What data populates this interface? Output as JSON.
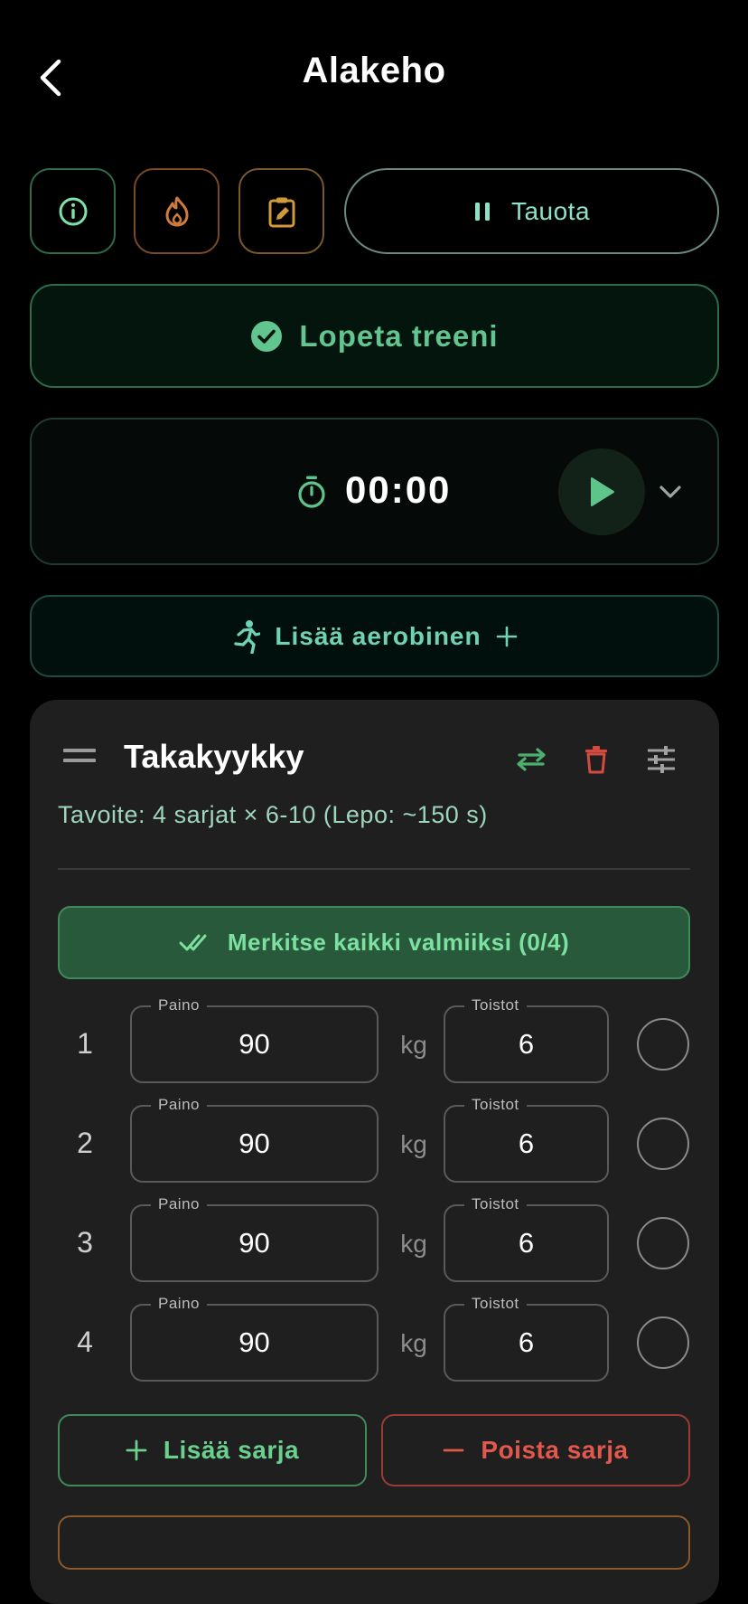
{
  "header": {
    "title": "Alakeho"
  },
  "toolbar": {
    "pause_label": "Tauota"
  },
  "finish": {
    "label": "Lopeta treeni"
  },
  "timer": {
    "value": "00:00"
  },
  "cardio": {
    "label": "Lisää aerobinen"
  },
  "exercise": {
    "name": "Takakyykky",
    "target": "Tavoite: 4 sarjat × 6-10 (Lepo: ~150 s)",
    "mark_all_label": "Merkitse kaikki valmiiksi (0/4)",
    "weight_label": "Paino",
    "reps_label": "Toistot",
    "unit": "kg",
    "sets": [
      {
        "num": "1",
        "weight": "90",
        "reps": "6",
        "done": false
      },
      {
        "num": "2",
        "weight": "90",
        "reps": "6",
        "done": false
      },
      {
        "num": "3",
        "weight": "90",
        "reps": "6",
        "done": false
      },
      {
        "num": "4",
        "weight": "90",
        "reps": "6",
        "done": false
      }
    ],
    "add_set_label": "Lisää sarja",
    "remove_set_label": "Poista sarja"
  },
  "colors": {
    "accent_green": "#62c48e",
    "accent_teal": "#6fd2b4",
    "danger_red": "#e2584d",
    "warning_orange": "#c8773a",
    "background": "#000000",
    "card": "#1f1f1f"
  },
  "icons": {
    "back": "chevron-left-icon",
    "info": "info-icon",
    "fire": "fire-icon",
    "clipboard": "clipboard-edit-icon",
    "pause": "pause-icon",
    "check": "check-circle-icon",
    "stopwatch": "stopwatch-icon",
    "play": "play-icon",
    "expand": "chevron-down-icon",
    "run": "running-person-icon",
    "drag": "drag-handle-icon",
    "swap": "swap-icon",
    "delete": "trash-icon",
    "tune": "tune-icon",
    "double_check": "double-check-icon"
  }
}
